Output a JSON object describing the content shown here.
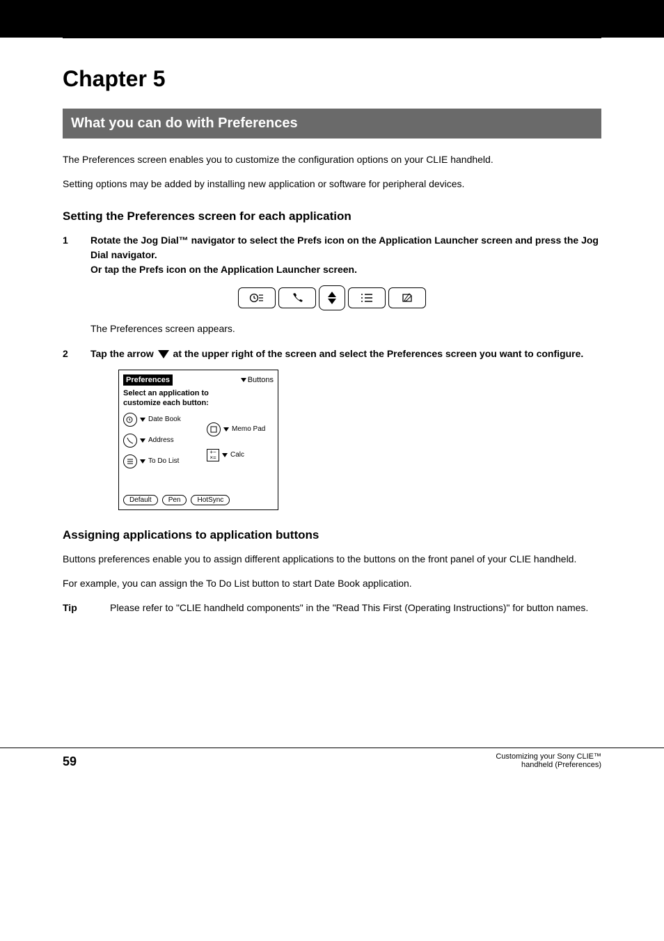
{
  "chapter_title": "Chapter 5",
  "section_banner": "What you can do with Preferences",
  "intro_p1": "The Preferences screen enables you to customize the configuration options on your CLIE handheld.",
  "intro_p2": "Setting options may be added by installing new application or software for peripheral devices.",
  "subhead1": "Setting the Preferences screen for each application",
  "steps": [
    {
      "num": "1",
      "text_before": "Rotate the Jog Dial™ navigator to select the Prefs icon on the Application Launcher screen and press the Jog Dial navigator.",
      "text_after": "The Preferences screen appears.",
      "text_or": "Or tap the Prefs icon on the Application Launcher screen."
    },
    {
      "num": "2",
      "text": "Tap the arrow ▼ at the upper right of the screen and select the Preferences screen you want to configure."
    }
  ],
  "screenshot": {
    "title": "Preferences",
    "menu": "Buttons",
    "subtitle_line1": "Select an application to",
    "subtitle_line2": "customize each button:",
    "items_left": [
      "Date Book",
      "Address",
      "To Do List"
    ],
    "items_right": [
      "Memo Pad",
      "Calc"
    ],
    "buttons": [
      "Default",
      "Pen",
      "HotSync"
    ]
  },
  "subhead2": "Assigning applications to application buttons",
  "body2_p1": "Buttons preferences enable you to assign different applications to the buttons on the front panel of your CLIE handheld.",
  "body2_p2_a": "For example, you can assign the To Do List button to start Date Book application.",
  "tip_label": "Tip",
  "tip_text": "Please refer to \"CLIE handheld components\" in the \"Read This First (Operating Instructions)\" for button names.",
  "hardware": {
    "btn1": "clock-icon",
    "btn2": "phone-icon",
    "btn3": "list-icon",
    "btn4": "note-icon"
  },
  "footer": {
    "page_num": "59",
    "line1": "Customizing your Sony CLIE™",
    "line2": "handheld (Preferences)"
  }
}
